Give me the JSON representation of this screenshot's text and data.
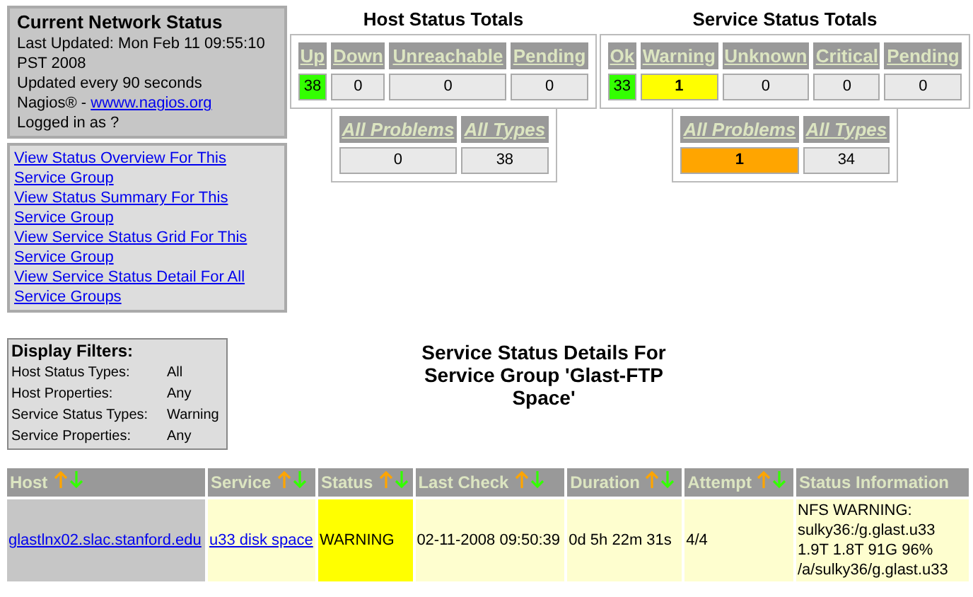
{
  "info": {
    "title": "Current Network Status",
    "lines": [
      "Last Updated: Mon Feb 11 09:55:10 PST 2008",
      "Updated every 90 seconds"
    ],
    "brand": "Nagios® - ",
    "brand_link": "wwww.nagios.org",
    "login": "Logged in as ?"
  },
  "links": [
    "View Status Overview For This Service Group",
    "View Status Summary For This Service Group",
    "View Service Status Grid For This Service Group",
    "View Service Status Detail For All Service Groups"
  ],
  "host_totals": {
    "title": "Host Status Totals",
    "cells": [
      {
        "label": "Up",
        "value": "38",
        "kind": "ok"
      },
      {
        "label": "Down",
        "value": "0",
        "kind": "plain"
      },
      {
        "label": "Unreachable",
        "value": "0",
        "kind": "plain"
      },
      {
        "label": "Pending",
        "value": "0",
        "kind": "plain"
      }
    ],
    "summary": [
      {
        "label": "All Problems",
        "value": "0",
        "kind": "plain"
      },
      {
        "label": "All Types",
        "value": "38",
        "kind": "plain"
      }
    ]
  },
  "service_totals": {
    "title": "Service Status Totals",
    "cells": [
      {
        "label": "Ok",
        "value": "33",
        "kind": "ok"
      },
      {
        "label": "Warning",
        "value": "1",
        "kind": "warning"
      },
      {
        "label": "Unknown",
        "value": "0",
        "kind": "plain"
      },
      {
        "label": "Critical",
        "value": "0",
        "kind": "plain"
      },
      {
        "label": "Pending",
        "value": "0",
        "kind": "plain"
      }
    ],
    "summary": [
      {
        "label": "All Problems",
        "value": "1",
        "kind": "problem"
      },
      {
        "label": "All Types",
        "value": "34",
        "kind": "plain"
      }
    ]
  },
  "filters": {
    "title": "Display Filters:",
    "rows": [
      {
        "label": "Host Status Types:",
        "value": "All"
      },
      {
        "label": "Host Properties:",
        "value": "Any"
      },
      {
        "label": "Service Status Types:",
        "value": "Warning"
      },
      {
        "label": "Service Properties:",
        "value": "Any"
      }
    ]
  },
  "heading": "Service Status Details For Service Group 'Glast-FTP Space'",
  "table": {
    "columns": [
      {
        "label": "Host",
        "sortable": true
      },
      {
        "label": "Service",
        "sortable": true
      },
      {
        "label": "Status",
        "sortable": true
      },
      {
        "label": "Last Check",
        "sortable": true
      },
      {
        "label": "Duration",
        "sortable": true
      },
      {
        "label": "Attempt",
        "sortable": true
      },
      {
        "label": "Status Information",
        "sortable": false
      }
    ],
    "rows": [
      {
        "host": "glastlnx02.slac.stanford.edu",
        "service": "u33 disk space",
        "status": "WARNING",
        "kind": "warning",
        "last_check": "02-11-2008 09:50:39",
        "duration": "0d 5h 22m 31s",
        "attempt": "4/4",
        "info": "NFS WARNING: sulky36:/g.glast.u33 1.9T 1.8T 91G 96% /a/sulky36/g.glast.u33"
      }
    ]
  }
}
